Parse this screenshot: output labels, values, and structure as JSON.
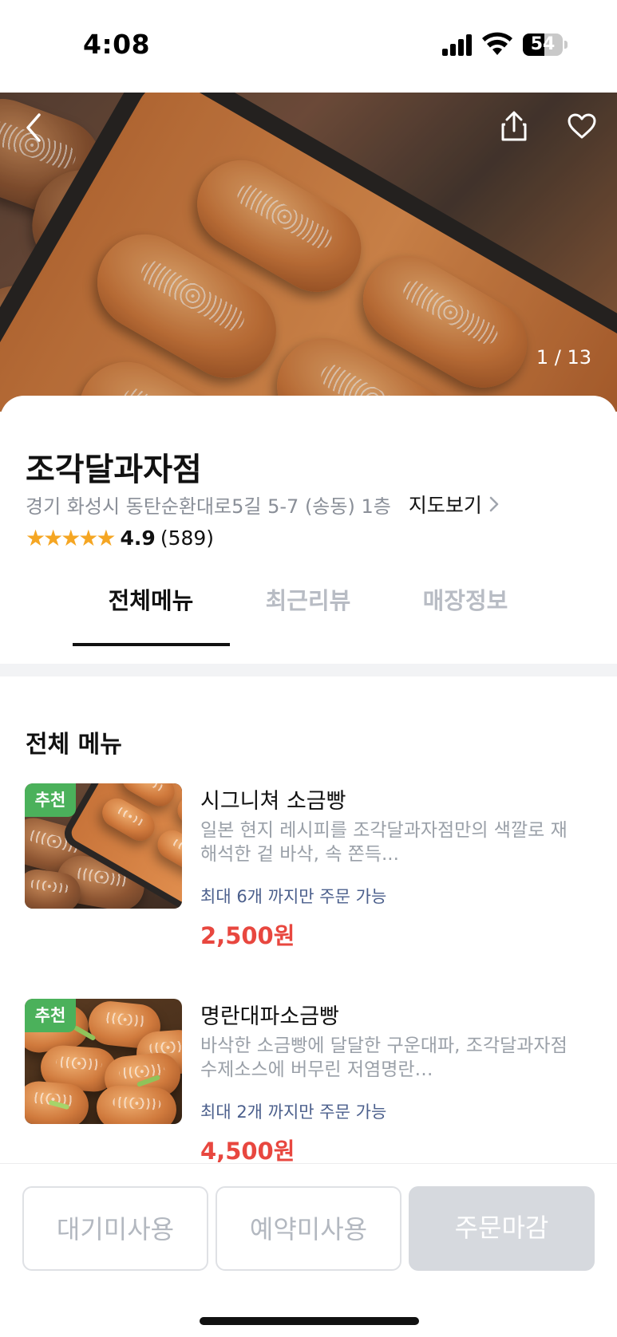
{
  "status_bar": {
    "time": "4:08",
    "battery": "54",
    "battery_level": 0.54
  },
  "hero": {
    "counter": "1 / 13",
    "back_icon": "chevron-left-icon",
    "share_icon": "share-icon",
    "like_icon": "heart-icon"
  },
  "store": {
    "name": "조각달과자점",
    "address": "경기 화성시 동탄순환대로5길 5-7 (송동) 1층",
    "map_link": "지도보기",
    "stars": "★★★★★",
    "rating": "4.9",
    "review_count": "(589)"
  },
  "tabs": [
    {
      "label": "전체메뉴",
      "active": true
    },
    {
      "label": "최근리뷰",
      "active": false
    },
    {
      "label": "매장정보",
      "active": false
    }
  ],
  "menu": {
    "section_title": "전체 메뉴",
    "items": [
      {
        "badge": "추천",
        "name": "시그니쳐 소금빵",
        "description": "일본 현지 레시피를 조각달과자점만의 색깔로 재해석한 겉 바삭, 속 쫀득...",
        "limit": "최대 6개 까지만 주문 가능",
        "price": "2,500원"
      },
      {
        "badge": "추천",
        "name": "명란대파소금빵",
        "description": "바삭한 소금빵에 달달한 구운대파, 조각달과자점 수제소스에 버무린 저염명란…",
        "limit": "최대 2개 까지만 주문 가능",
        "price": "4,500원"
      }
    ]
  },
  "bottom_buttons": {
    "waitlist": "대기미사용",
    "reservation": "예약미사용",
    "order": "주문마감"
  },
  "colors": {
    "accent_price": "#e8473f",
    "badge_green": "#4bb15b",
    "star": "#f5a623",
    "limit_text": "#4b5f8c"
  }
}
